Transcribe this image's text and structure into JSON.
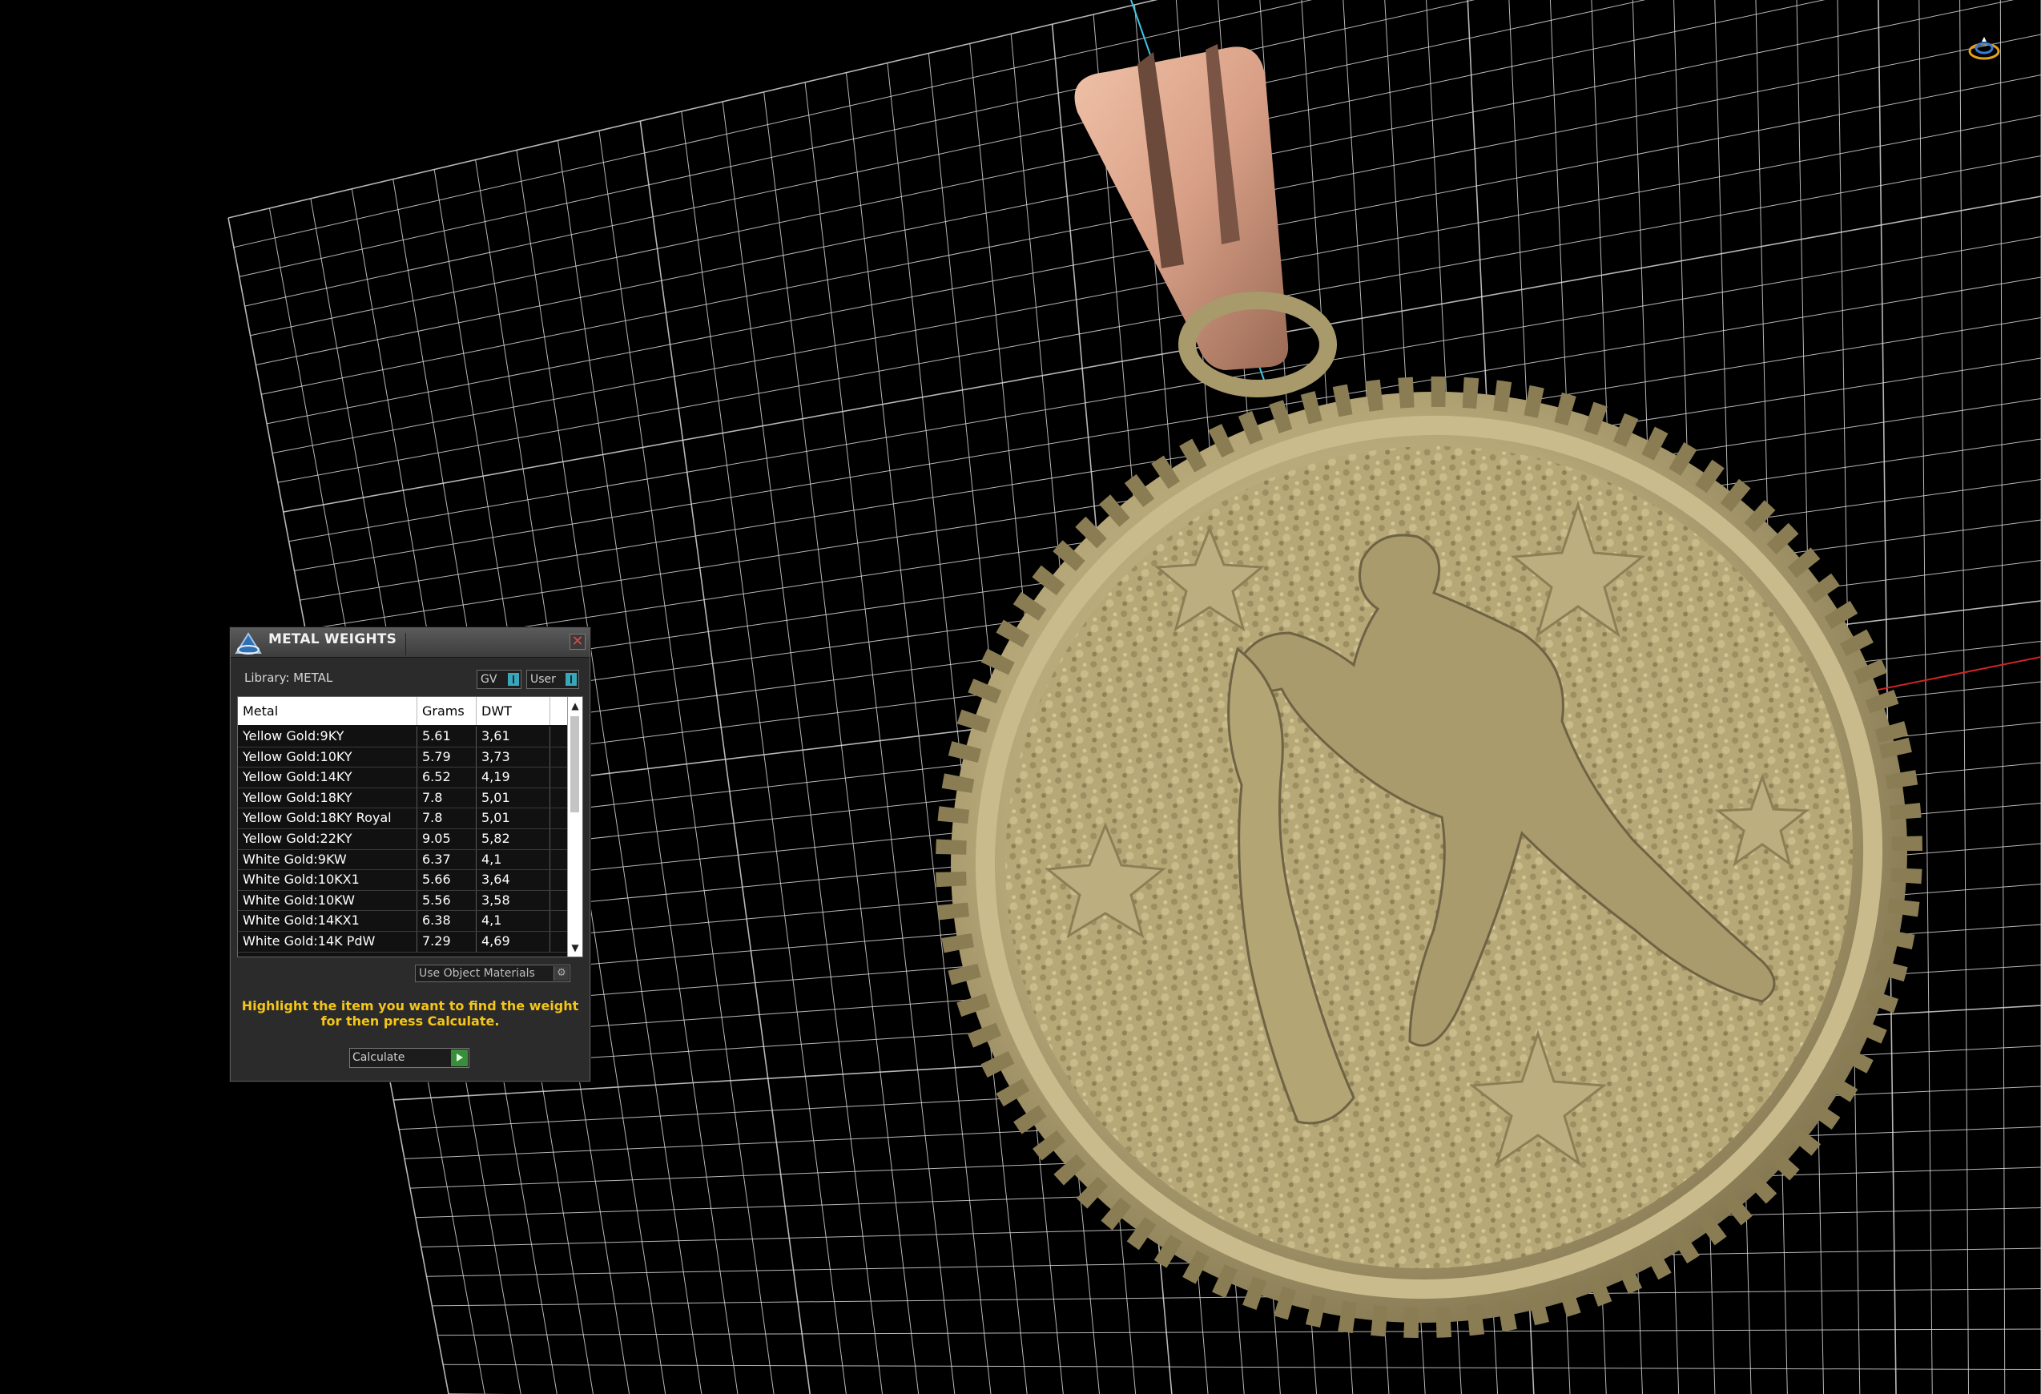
{
  "viewport": {
    "grid_color": "#d8d8d8",
    "background": "#000000",
    "axis_y_color": "#3ec7e6",
    "axis_x_color": "#d22424",
    "model_color": "#b5a677",
    "bail_color": "#d89f86"
  },
  "metal_weights": {
    "title": "METAL WEIGHTS",
    "library_label": "Library: METAL",
    "toggle_gv": "GV",
    "toggle_user": "User",
    "columns": [
      "Metal",
      "Grams",
      "DWT"
    ],
    "rows": [
      {
        "metal": "Yellow Gold:9KY",
        "grams": "5.61",
        "dwt": "3,61"
      },
      {
        "metal": "Yellow Gold:10KY",
        "grams": "5.79",
        "dwt": "3,73"
      },
      {
        "metal": "Yellow Gold:14KY",
        "grams": "6.52",
        "dwt": "4,19"
      },
      {
        "metal": "Yellow Gold:18KY",
        "grams": "7.8",
        "dwt": "5,01"
      },
      {
        "metal": "Yellow Gold:18KY Royal",
        "grams": "7.8",
        "dwt": "5,01"
      },
      {
        "metal": "Yellow Gold:22KY",
        "grams": "9.05",
        "dwt": "5,82"
      },
      {
        "metal": "White Gold:9KW",
        "grams": "6.37",
        "dwt": "4,1"
      },
      {
        "metal": "White Gold:10KX1",
        "grams": "5.66",
        "dwt": "3,64"
      },
      {
        "metal": "White Gold:10KW",
        "grams": "5.56",
        "dwt": "3,58"
      },
      {
        "metal": "White Gold:14KX1",
        "grams": "6.38",
        "dwt": "4,1"
      },
      {
        "metal": "White Gold:14K PdW",
        "grams": "7.29",
        "dwt": "4,69"
      }
    ],
    "use_object_materials": "Use Object Materials",
    "hint": "Highlight the item you want to find the weight for then press Calculate.",
    "calculate": "Calculate",
    "close_label": "✕"
  }
}
